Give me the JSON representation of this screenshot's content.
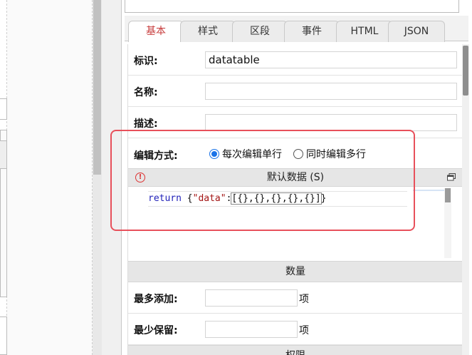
{
  "panel": {
    "top_fragment": "——— —— ———— ——"
  },
  "tabs": [
    {
      "label": "基本",
      "active": true
    },
    {
      "label": "样式",
      "active": false
    },
    {
      "label": "区段",
      "active": false
    },
    {
      "label": "事件",
      "active": false
    },
    {
      "label": "HTML",
      "active": false
    },
    {
      "label": "JSON",
      "active": false
    }
  ],
  "form": {
    "id_label": "标识:",
    "id_value": "datatable",
    "name_label": "名称:",
    "name_value": "",
    "desc_label": "描述:",
    "desc_value": "",
    "edit_mode_label": "编辑方式:",
    "edit_mode_options": [
      {
        "label": "每次编辑单行",
        "checked": true
      },
      {
        "label": "同时编辑多行",
        "checked": false
      }
    ]
  },
  "default_data": {
    "title": "默认数据 (S)",
    "code_keyword": "return",
    "code_open": " {",
    "code_string": "\"data\"",
    "code_colon": ":",
    "code_array": "[{},{},{},{},{}]",
    "code_close": "}"
  },
  "quantity": {
    "title": "数量",
    "max_label": "最多添加:",
    "max_value": "",
    "max_unit": "项",
    "min_label": "最少保留:",
    "min_value": "",
    "min_unit": "项"
  },
  "permissions": {
    "title": "权限"
  },
  "colors": {
    "active_tab": "#c73c3c",
    "highlight": "#e8505b",
    "radio_on": "#1a73e8"
  }
}
